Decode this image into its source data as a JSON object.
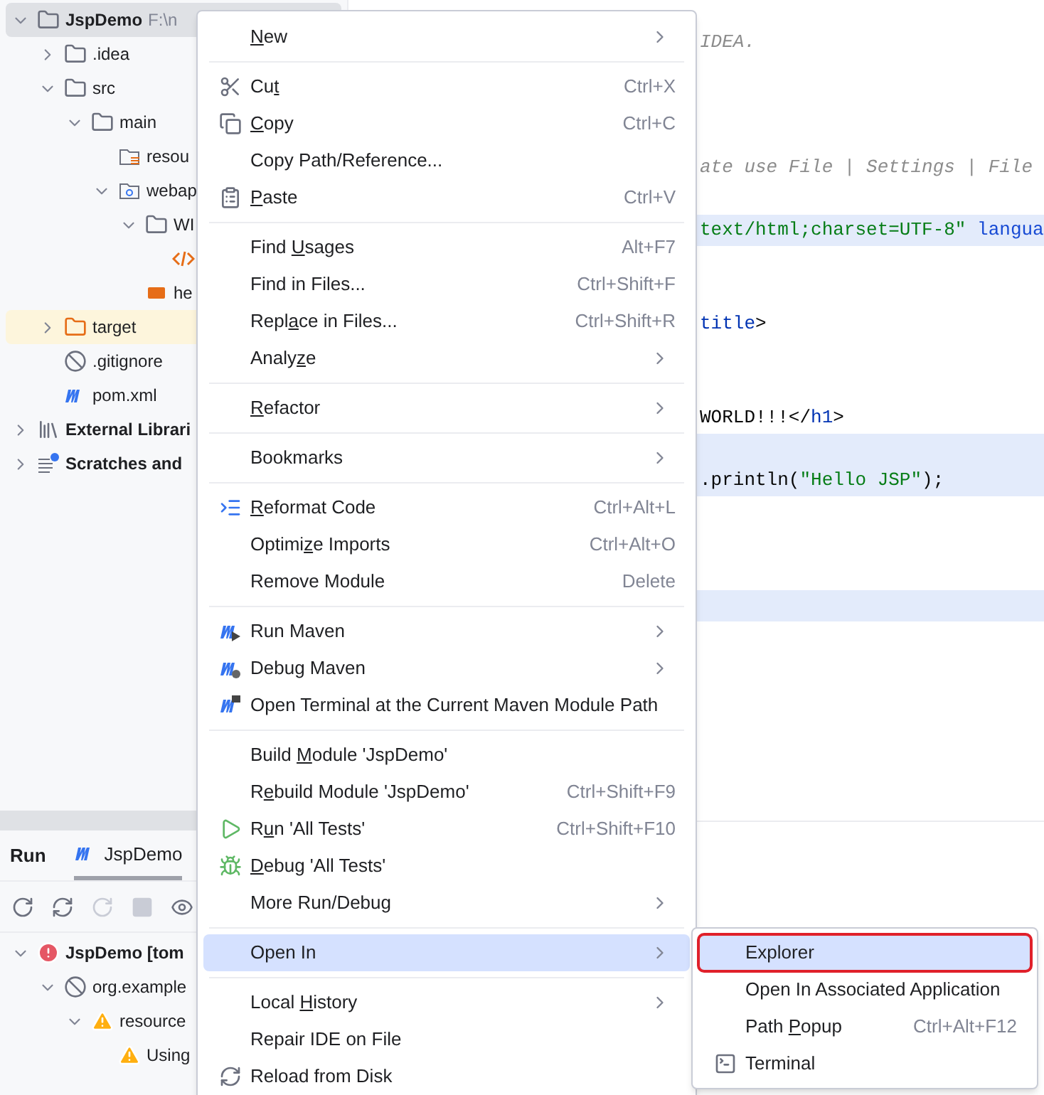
{
  "project_tree": [
    {
      "label": "JspDemo",
      "path": "F:\\n",
      "kind": "project",
      "expanded": true,
      "selected": true,
      "ignored": false,
      "children": [
        {
          "label": ".idea",
          "kind": "folder",
          "expanded": false,
          "selected": false,
          "ignored": false
        },
        {
          "label": "src",
          "kind": "folder",
          "expanded": true,
          "selected": false,
          "ignored": false,
          "children": [
            {
              "label": "main",
              "kind": "folder",
              "expanded": true,
              "selected": false,
              "ignored": false,
              "children": [
                {
                  "label": "resou",
                  "kind": "resources",
                  "selected": false,
                  "ignored": false
                },
                {
                  "label": "webap",
                  "kind": "web",
                  "expanded": true,
                  "selected": false,
                  "ignored": false,
                  "children": [
                    {
                      "label": "WI",
                      "kind": "folder",
                      "expanded": true,
                      "selected": false,
                      "ignored": false,
                      "children": [
                        {
                          "kind": "html",
                          "selected": false,
                          "ignored": false
                        }
                      ]
                    },
                    {
                      "label": "he",
                      "kind": "jsp",
                      "selected": false,
                      "ignored": false
                    }
                  ]
                }
              ]
            }
          ]
        },
        {
          "label": "target",
          "kind": "excluded",
          "expanded": false,
          "selected": false,
          "ignored": true
        },
        {
          "label": ".gitignore",
          "kind": "gitignore",
          "selected": false,
          "ignored": false
        },
        {
          "label": "pom.xml",
          "kind": "maven",
          "selected": false,
          "ignored": false
        }
      ]
    },
    {
      "label": "External Librari",
      "kind": "library",
      "expanded": false,
      "selected": false,
      "ignored": false
    },
    {
      "label": "Scratches and",
      "kind": "scratches",
      "expanded": false,
      "selected": false,
      "ignored": false
    }
  ],
  "editor": {
    "lines": [
      {
        "highlighted": false,
        "segments": [
          {
            "kind": "comment",
            "text": "IDEA."
          }
        ]
      },
      {
        "highlighted": false
      },
      {
        "highlighted": false
      },
      {
        "highlighted": false
      },
      {
        "highlighted": false,
        "segments": [
          {
            "kind": "comment",
            "text": "ate use File | Settings | File"
          }
        ]
      },
      {
        "highlighted": false
      },
      {
        "highlighted": true,
        "segments": [
          {
            "kind": "string",
            "text": "text/html;charset=UTF-8\""
          },
          {
            "kind": "attribute",
            "text": " langua"
          }
        ]
      },
      {
        "highlighted": false
      },
      {
        "highlighted": false
      },
      {
        "highlighted": false,
        "segments": [
          {
            "kind": "tag",
            "text": "title"
          },
          {
            "kind": "plain",
            "text": ">"
          }
        ]
      },
      {
        "highlighted": false
      },
      {
        "highlighted": false
      },
      {
        "highlighted": false,
        "segments": [
          {
            "kind": "plain",
            "text": "WORLD!!!</"
          },
          {
            "kind": "tag",
            "text": "h1"
          },
          {
            "kind": "plain",
            "text": ">"
          }
        ]
      },
      {
        "highlighted": true
      },
      {
        "highlighted": true,
        "segments": [
          {
            "kind": "plain",
            "text": ".println("
          },
          {
            "kind": "string",
            "text": "\"Hello JSP\""
          },
          {
            "kind": "plain",
            "text": ");"
          }
        ]
      },
      {
        "highlighted": false
      },
      {
        "highlighted": false
      },
      {
        "highlighted": false
      },
      {
        "highlighted": true
      }
    ]
  },
  "run_panel": {
    "title": "Run",
    "tabs": [
      {
        "label": "JspDemo",
        "selected": true
      }
    ],
    "tree": [
      {
        "label": "JspDemo [tom",
        "kind": "error",
        "expanded": true,
        "children": [
          {
            "label": "org.example",
            "kind": "blocked",
            "expanded": true,
            "children": [
              {
                "label": "resource",
                "kind": "warning",
                "expanded": true,
                "children": [
                  {
                    "label": "Using",
                    "kind": "warning"
                  }
                ]
              }
            ]
          }
        ]
      }
    ]
  },
  "context_menu": [
    {
      "kind": "plain",
      "key": "N",
      "post": "ew",
      "submenu": true,
      "selected": false
    },
    {
      "kind": "separator"
    },
    {
      "kind": "cut",
      "pre": "Cu",
      "key": "t",
      "shortcut": "Ctrl+X",
      "submenu": false,
      "selected": false
    },
    {
      "kind": "copy",
      "key": "C",
      "post": "opy",
      "shortcut": "Ctrl+C",
      "submenu": false,
      "selected": false
    },
    {
      "kind": "plain",
      "pre": "Copy Path/Reference...",
      "submenu": false,
      "selected": false
    },
    {
      "kind": "paste",
      "key": "P",
      "post": "aste",
      "shortcut": "Ctrl+V",
      "submenu": false,
      "selected": false
    },
    {
      "kind": "separator"
    },
    {
      "kind": "plain",
      "pre": "Find ",
      "key": "U",
      "post": "sages",
      "shortcut": "Alt+F7",
      "submenu": false,
      "selected": false
    },
    {
      "kind": "plain",
      "pre": "Find in Files...",
      "shortcut": "Ctrl+Shift+F",
      "submenu": false,
      "selected": false
    },
    {
      "kind": "plain",
      "pre": "Repl",
      "key": "a",
      "post": "ce in Files...",
      "shortcut": "Ctrl+Shift+R",
      "submenu": false,
      "selected": false
    },
    {
      "kind": "plain",
      "pre": "Analy",
      "key": "z",
      "post": "e",
      "submenu": true,
      "selected": false
    },
    {
      "kind": "separator"
    },
    {
      "kind": "plain",
      "key": "R",
      "post": "efactor",
      "submenu": true,
      "selected": false
    },
    {
      "kind": "separator"
    },
    {
      "kind": "plain",
      "pre": "Bookmarks",
      "submenu": true,
      "selected": false
    },
    {
      "kind": "separator"
    },
    {
      "kind": "reformat",
      "key": "R",
      "post": "eformat Code",
      "shortcut": "Ctrl+Alt+L",
      "submenu": false,
      "selected": false
    },
    {
      "kind": "plain",
      "pre": "Optimi",
      "key": "z",
      "post": "e Imports",
      "shortcut": "Ctrl+Alt+O",
      "submenu": false,
      "selected": false
    },
    {
      "kind": "plain",
      "pre": "Remove Module",
      "shortcut": "Delete",
      "submenu": false,
      "selected": false
    },
    {
      "kind": "separator"
    },
    {
      "kind": "run-maven",
      "pre": "Run Maven",
      "submenu": true,
      "selected": false
    },
    {
      "kind": "debug-maven",
      "pre": "Debug Maven",
      "submenu": true,
      "selected": false
    },
    {
      "kind": "maven-terminal",
      "pre": "Open Terminal at the Current Maven Module Path",
      "submenu": false,
      "selected": false
    },
    {
      "kind": "separator"
    },
    {
      "kind": "plain",
      "pre": "Build ",
      "key": "M",
      "post": "odule 'JspDemo'",
      "submenu": false,
      "selected": false
    },
    {
      "kind": "plain",
      "pre": "R",
      "key": "e",
      "post": "build Module 'JspDemo'",
      "shortcut": "Ctrl+Shift+F9",
      "submenu": false,
      "selected": false
    },
    {
      "kind": "run",
      "pre": "R",
      "key": "u",
      "post": "n 'All Tests'",
      "shortcut": "Ctrl+Shift+F10",
      "submenu": false,
      "selected": false
    },
    {
      "kind": "debug",
      "key": "D",
      "post": "ebug 'All Tests'",
      "submenu": false,
      "selected": false
    },
    {
      "kind": "plain",
      "pre": "More Run/Debug",
      "submenu": true,
      "selected": false
    },
    {
      "kind": "separator"
    },
    {
      "kind": "plain",
      "pre": "Open In",
      "submenu": true,
      "selected": true
    },
    {
      "kind": "separator"
    },
    {
      "kind": "plain",
      "pre": "Local ",
      "key": "H",
      "post": "istory",
      "submenu": true,
      "selected": false
    },
    {
      "kind": "plain",
      "pre": "Repair IDE on File",
      "submenu": false,
      "selected": false
    },
    {
      "kind": "reload",
      "pre": "Reload from Disk",
      "submenu": false,
      "selected": false
    }
  ],
  "submenu": [
    {
      "kind": "plain",
      "pre": "Explorer",
      "selected": true,
      "outlined": true
    },
    {
      "kind": "plain",
      "pre": "Open In Associated Application",
      "selected": false,
      "outlined": false
    },
    {
      "kind": "plain",
      "pre": "Path ",
      "key": "P",
      "post": "opup",
      "shortcut": "Ctrl+Alt+F12",
      "selected": false,
      "outlined": false
    },
    {
      "kind": "terminal",
      "pre": "Terminal",
      "selected": false,
      "outlined": false
    }
  ]
}
